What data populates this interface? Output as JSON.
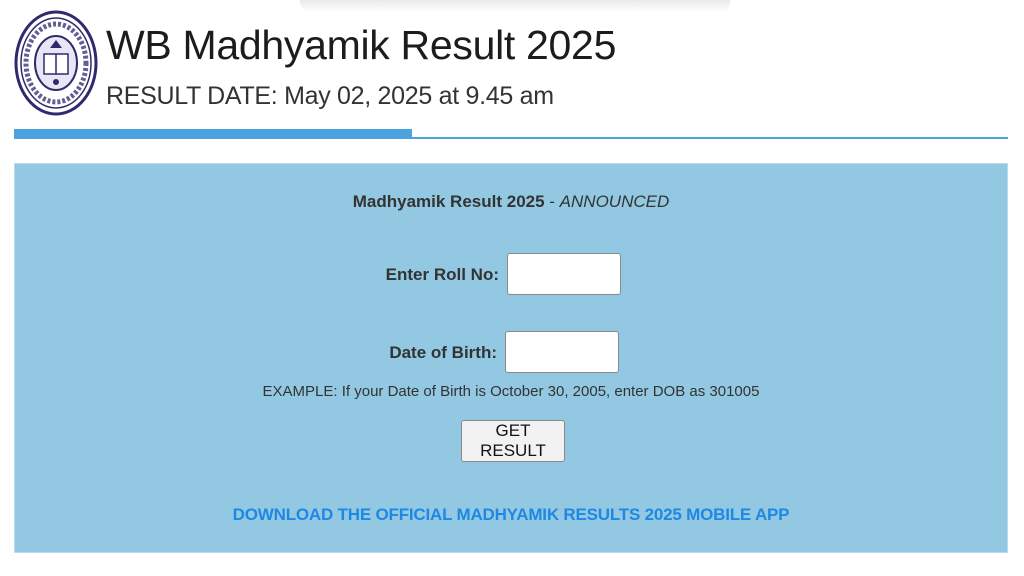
{
  "header": {
    "title": "WB Madhyamik Result 2025",
    "result_date": "RESULT DATE: May 02, 2025 at 9.45 am",
    "logo_icon": "wbbse-seal-logo"
  },
  "form": {
    "heading_bold": "Madhyamik Result 2025",
    "heading_separator": " - ",
    "heading_status": "ANNOUNCED",
    "roll_label": "Enter Roll No:",
    "roll_value": "",
    "dob_label": "Date of Birth:",
    "dob_value": "",
    "example_text": "EXAMPLE: If your Date of Birth is October 30, 2005, enter DOB as 301005",
    "submit_label": "GET RESULT"
  },
  "download_link": "DOWNLOAD THE OFFICIAL MADHYAMIK RESULTS 2025 MOBILE APP",
  "colors": {
    "accent_blue": "#4aa3df",
    "panel_bg": "#93c8e2",
    "link_blue": "#1e88e5"
  }
}
